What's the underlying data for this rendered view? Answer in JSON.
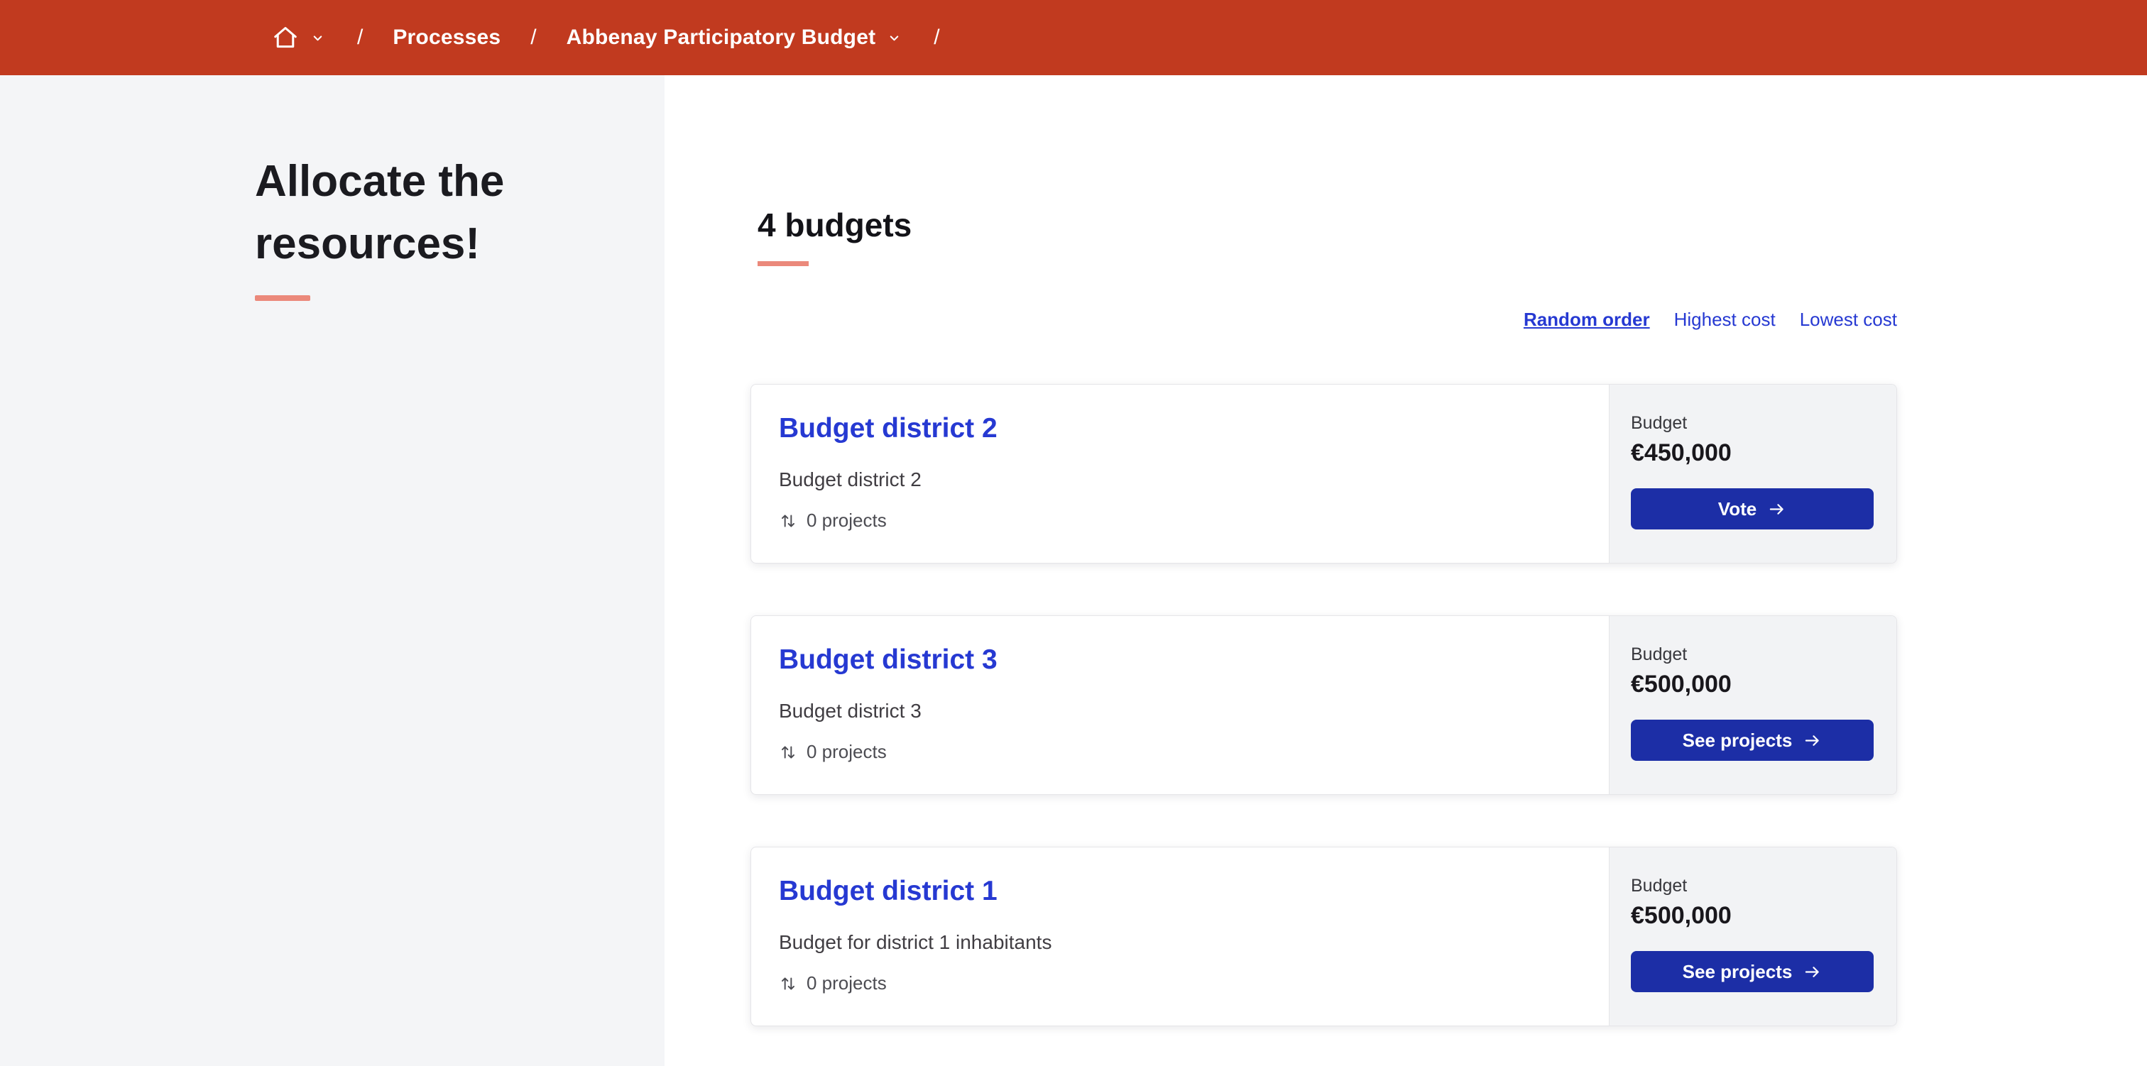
{
  "breadcrumb": {
    "separator": "/",
    "processes_label": "Processes",
    "process_name": "Abbenay Participatory Budget"
  },
  "sidebar": {
    "title": "Allocate the resources!"
  },
  "main": {
    "heading": "4 budgets",
    "sort_options": [
      {
        "label": "Random order",
        "active": true
      },
      {
        "label": "Highest cost",
        "active": false
      },
      {
        "label": "Lowest cost",
        "active": false
      }
    ],
    "cards": [
      {
        "title": "Budget district 2",
        "subtitle": "Budget district 2",
        "projects": "0 projects",
        "budget_label": "Budget",
        "amount": "€450,000",
        "button_label": "Vote"
      },
      {
        "title": "Budget district 3",
        "subtitle": "Budget district 3",
        "projects": "0 projects",
        "budget_label": "Budget",
        "amount": "€500,000",
        "button_label": "See projects"
      },
      {
        "title": "Budget district 1",
        "subtitle": "Budget for district 1 inhabitants",
        "projects": "0 projects",
        "budget_label": "Budget",
        "amount": "€500,000",
        "button_label": "See projects"
      }
    ]
  },
  "colors": {
    "header_red": "#c13a1f",
    "accent_salmon": "#eb897b",
    "link_blue": "#2639d2",
    "button_blue": "#1c2ea6"
  }
}
